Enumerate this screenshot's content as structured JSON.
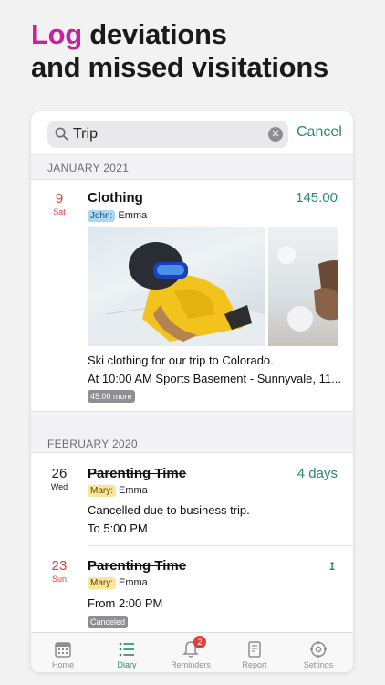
{
  "headline": {
    "accent": "Log",
    "rest": "deviations",
    "line2": "and missed visitations"
  },
  "search": {
    "query": "Trip",
    "cancel_label": "Cancel"
  },
  "sections": [
    {
      "label": "JANUARY 2021"
    },
    {
      "label": "FEBRUARY 2020"
    }
  ],
  "entries": [
    {
      "day": "9",
      "weekday": "Sat",
      "title": "Clothing",
      "amount": "145.00",
      "parent_tag": "John:",
      "child": "Emma",
      "note": "Ski clothing for our trip to Colorado.",
      "time_location": "At 10:00 AM  Sports Basement - Sunnyvale, 11...",
      "pill": "45.00 more"
    },
    {
      "day": "26",
      "weekday": "Wed",
      "title": "Parenting Time",
      "amount": "4 days",
      "parent_tag": "Mary:",
      "child": "Emma",
      "note": "Cancelled due to business trip.",
      "time": "To 5:00 PM"
    },
    {
      "day": "23",
      "weekday": "Sun",
      "title": "Parenting Time",
      "parent_tag": "Mary:",
      "child": "Emma",
      "time": "From 2:00 PM",
      "pill": "Canceled"
    }
  ],
  "tabs": [
    {
      "label": "Home",
      "icon": "calendar-icon"
    },
    {
      "label": "Diary",
      "icon": "list-icon"
    },
    {
      "label": "Reminders",
      "icon": "bell-icon",
      "badge": "2"
    },
    {
      "label": "Report",
      "icon": "report-icon"
    },
    {
      "label": "Settings",
      "icon": "gear-icon"
    }
  ],
  "colors": {
    "accent": "#c2259b",
    "green": "#2a8a68",
    "red": "#e0413a"
  }
}
